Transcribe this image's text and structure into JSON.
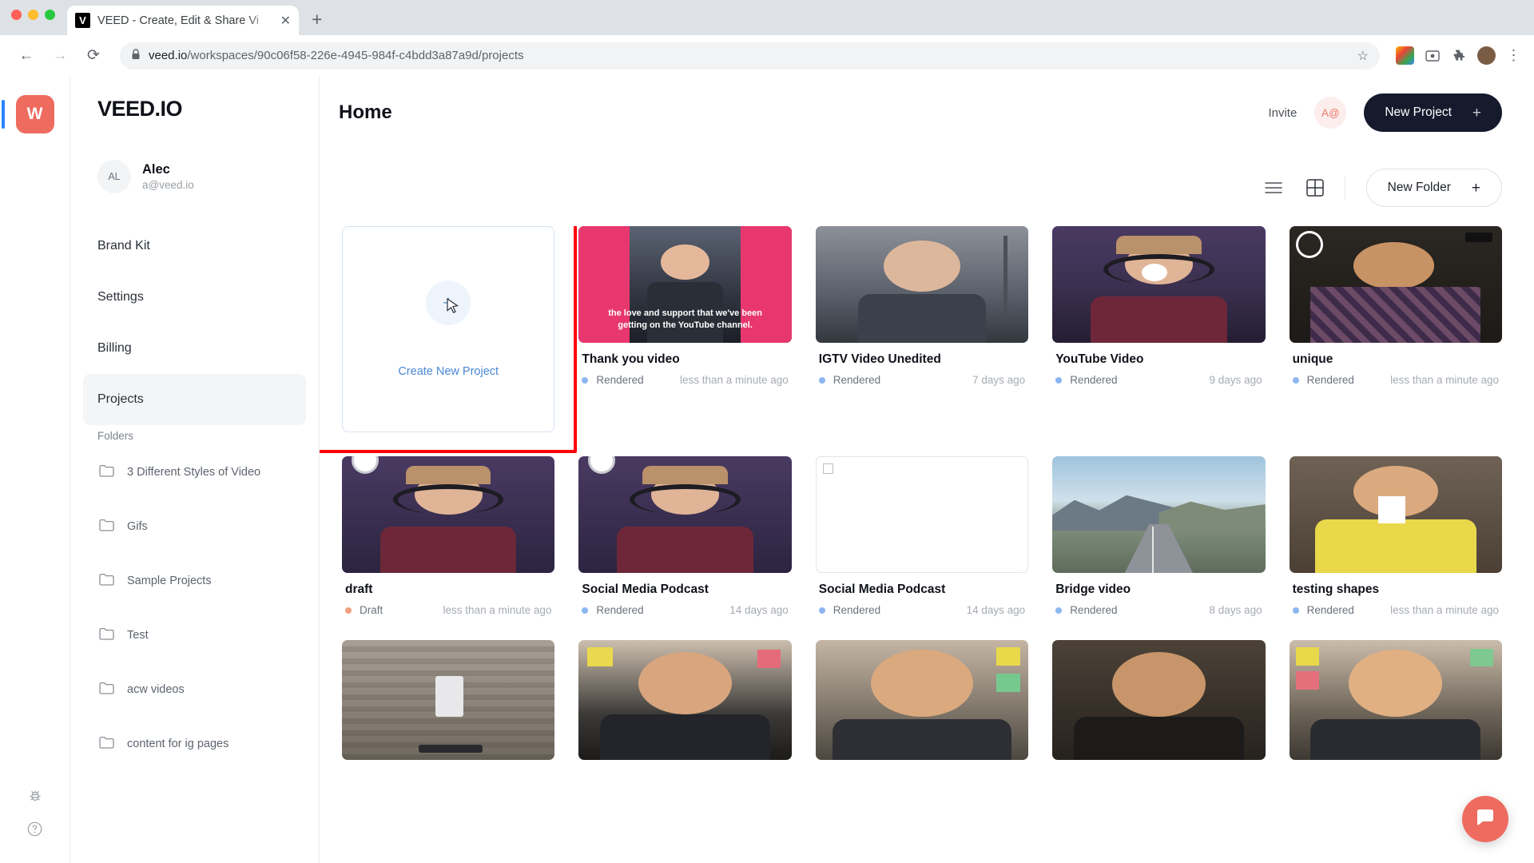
{
  "browser": {
    "tab": {
      "favicon_letter": "V",
      "title": "VEED - Create, Edit & Share Vi",
      "close": "✕"
    },
    "new_tab_label": "+",
    "nav": {
      "back": "←",
      "forward": "→",
      "reload": "⟳"
    },
    "url_prefix": "veed.io",
    "url_rest": "/workspaces/90c06f58-226e-4945-984f-c4bdd3a87a9d/projects",
    "lock_icon": "lock-icon",
    "star": "☆",
    "menu": "⋮"
  },
  "rail": {
    "workspace_initial": "W",
    "bug_icon": "bug-icon",
    "help_icon": "help-icon"
  },
  "sidebar": {
    "brand": "VEED.IO",
    "user": {
      "initials": "AL",
      "name": "Alec",
      "email": "a@veed.io"
    },
    "nav": [
      {
        "label": "Brand Kit",
        "active": false
      },
      {
        "label": "Settings",
        "active": false
      },
      {
        "label": "Billing",
        "active": false
      },
      {
        "label": "Projects",
        "active": true
      }
    ],
    "folders_label": "Folders",
    "folders": [
      {
        "label": "3 Different Styles of Video"
      },
      {
        "label": "Gifs"
      },
      {
        "label": "Sample Projects"
      },
      {
        "label": "Test"
      },
      {
        "label": "acw videos"
      },
      {
        "label": "content for ig pages"
      }
    ]
  },
  "header": {
    "title": "Home",
    "invite_label": "Invite",
    "member_avatar": "A@",
    "new_project_label": "New Project",
    "new_project_plus": "+"
  },
  "toolbar": {
    "list_view_icon": "list-view-icon",
    "grid_view_icon": "grid-view-icon",
    "new_folder_label": "New Folder",
    "new_folder_plus": "+"
  },
  "create_card": {
    "label": "Create New Project",
    "plus": "+",
    "highlight_color": "#ff0000"
  },
  "status_colors": {
    "rendered": "#8cb6f0",
    "draft": "#f0a080"
  },
  "projects": [
    {
      "title": "Thank you video",
      "status": "Rendered",
      "time": "less than a minute ago",
      "thumb": "podcast-pink-caption"
    },
    {
      "title": "IGTV Video Unedited",
      "status": "Rendered",
      "time": "7 days ago",
      "thumb": "man-studio"
    },
    {
      "title": "YouTube Video",
      "status": "Rendered",
      "time": "9 days ago",
      "thumb": "man-headphones-purple"
    },
    {
      "title": "unique",
      "status": "Rendered",
      "time": "less than a minute ago",
      "thumb": "man-plaid-ring"
    },
    {
      "title": "draft",
      "status": "Draft",
      "time": "less than a minute ago",
      "thumb": "man-headphones-dark"
    },
    {
      "title": "Social Media Podcast",
      "status": "Rendered",
      "time": "14 days ago",
      "thumb": "man-headphones-purple2"
    },
    {
      "title": "Social Media Podcast",
      "status": "Rendered",
      "time": "14 days ago",
      "thumb": "blank-broken-image"
    },
    {
      "title": "Bridge video",
      "status": "Rendered",
      "time": "8 days ago",
      "thumb": "mountain-road"
    },
    {
      "title": "testing shapes",
      "status": "Rendered",
      "time": "less than a minute ago",
      "thumb": "man-yellow-shirt-square"
    }
  ],
  "third_row_thumbs": [
    "skateboard-wall",
    "man-sticky-notes",
    "man-sticky-notes-2",
    "man-dark-room",
    "man-sticky-notes-3"
  ],
  "chat": {
    "icon": "chat-icon",
    "color": "#ee6b5f"
  }
}
